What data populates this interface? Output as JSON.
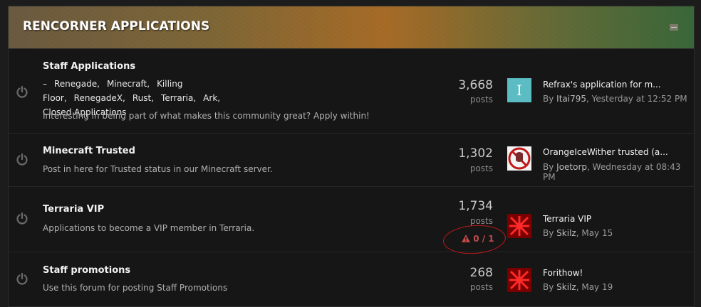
{
  "section": {
    "title": "RENCORNER APPLICATIONS"
  },
  "icons": {
    "forum": "power-icon",
    "warning": "warning-triangle-icon",
    "collapse": "collapse-icon"
  },
  "colors": {
    "warning": "#c34a4a",
    "annotation_circle": "#c01818",
    "avatar_I_bg": "#5bbcc4"
  },
  "forums": [
    {
      "title": "Staff Applications",
      "sublinks": [
        "–",
        "Renegade,",
        "Minecraft,",
        "Killing Floor,",
        "RenegadeX,",
        "Rust,",
        "Terraria,",
        "Ark,",
        "Closed Applications"
      ],
      "description": "Interesting in being part of what makes this community great? Apply within!",
      "count": "3,668",
      "count_label": "posts",
      "last_title": "Refrax's application for m...",
      "last_by": "By",
      "last_user": "Itai795",
      "last_time": ", Yesterday at 12:52 PM",
      "avatar_letter": "I"
    },
    {
      "title": "Minecraft Trusted",
      "description": "Post in here for Trusted status in our Minecraft server.",
      "count": "1,302",
      "count_label": "posts",
      "last_title": "OrangeIceWither trusted (a...",
      "last_by": "By",
      "last_user": "Joetorp",
      "last_time": ", Wednesday at 08:43 PM"
    },
    {
      "title": "Terraria VIP",
      "description": "Applications to become a VIP member in Terraria.",
      "count": "1,734",
      "count_label": "posts",
      "warning": "0 / 1",
      "last_title": "Terraria VIP",
      "last_by": "By",
      "last_user": "Skilz",
      "last_time": ", May 15"
    },
    {
      "title": "Staff promotions",
      "description": "Use this forum for posting Staff Promotions",
      "count": "268",
      "count_label": "posts",
      "last_title": "Forithow!",
      "last_by": "By",
      "last_user": "Skilz",
      "last_time": ", May 19"
    }
  ]
}
